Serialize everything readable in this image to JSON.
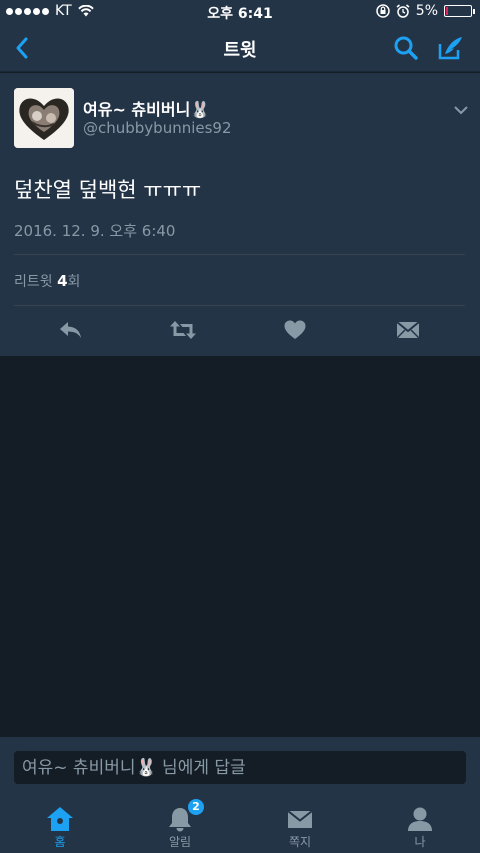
{
  "status_bar": {
    "carrier": "KT",
    "time": "오후 6:41",
    "battery_text": "5%",
    "battery_level": 0.05
  },
  "nav": {
    "title": "트윗"
  },
  "tweet": {
    "display_name": "여유~ 츄비버니🐰",
    "handle": "@chubbybunnies92",
    "text": "덮찬열 덮백현 ㅠㅠㅠ",
    "timestamp": "2016. 12. 9. 오후 6:40",
    "retweet_label": "리트윗",
    "retweet_count": "4",
    "retweet_suffix": "회"
  },
  "reply": {
    "placeholder": "여유~ 츄비버니🐰 님에게 답글"
  },
  "tabs": [
    {
      "label": "홈",
      "icon": "home-icon"
    },
    {
      "label": "알림",
      "icon": "bell-icon",
      "badge": "2"
    },
    {
      "label": "쪽지",
      "icon": "envelope-icon"
    },
    {
      "label": "나",
      "icon": "person-icon"
    }
  ],
  "colors": {
    "accent": "#1da1f2",
    "card": "#243447",
    "background": "#141d26",
    "muted": "#8899a6"
  }
}
